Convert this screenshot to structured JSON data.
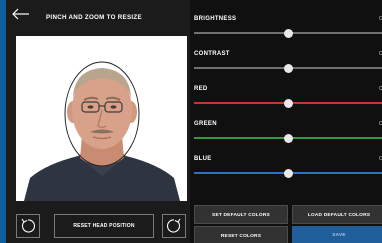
{
  "header": {
    "title": "PINCH AND ZOOM TO RESIZE"
  },
  "photo": {
    "background": "#ffffff",
    "oval_guide_color": "#222222"
  },
  "bottom_controls": {
    "rotate_left_icon": "rotate-ccw-icon",
    "reset_head_position_label": "RESET HEAD POSITION",
    "rotate_right_icon": "rotate-cw-icon"
  },
  "sliders": [
    {
      "label": "BRIGHTNESS",
      "value_fraction": 0.5,
      "track_color": "#6f6f6f",
      "value_glyph": "C"
    },
    {
      "label": "CONTRAST",
      "value_fraction": 0.5,
      "track_color": "#6f6f6f",
      "value_glyph": "C"
    },
    {
      "label": "RED",
      "value_fraction": 0.5,
      "track_color": "#c0392b",
      "value_glyph": "C"
    },
    {
      "label": "GREEN",
      "value_fraction": 0.5,
      "track_color": "#2e9e45",
      "value_glyph": "C"
    },
    {
      "label": "BLUE",
      "value_fraction": 0.5,
      "track_color": "#2f6fc9",
      "value_glyph": "C"
    }
  ],
  "actions": {
    "set_default_colors": "SET DEFAULT COLORS",
    "load_default_colors": "LOAD DEFAULT COLORS",
    "reset_colors": "RESET COLORS",
    "save": "SAVE"
  },
  "colors": {
    "accent": "#0f5f9e",
    "panel": "#1b1b1b",
    "save_button": "#1f5e9a"
  }
}
